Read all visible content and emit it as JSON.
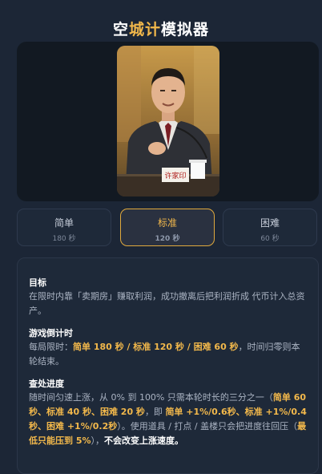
{
  "header": {
    "title_a": "空",
    "title_b": "城计",
    "title_c": "模拟器"
  },
  "photo": {
    "nameplate": "许家印"
  },
  "difficulty": [
    {
      "name": "简单",
      "time": "180 秒",
      "active": false
    },
    {
      "name": "标准",
      "time": "120 秒",
      "active": true
    },
    {
      "name": "困难",
      "time": "60 秒",
      "active": false
    }
  ],
  "rules": {
    "goal": {
      "title": "目标",
      "body": "在限时内靠「卖期房」赚取利润，成功撤离后把利润折成 代币计入总资产。"
    },
    "timer": {
      "title": "游戏倒计时",
      "body_a": "每局限时：",
      "body_b": "简单 180 秒 / 标准 120 秒 / 困难 60 秒",
      "body_c": "，时间归零则本轮结束。"
    },
    "progress": {
      "title": "查处进度",
      "p1": "随时间匀速上涨，从 0% 到 100% 只需本轮时长的三分之一（",
      "p2": "简单 60 秒、标准 40 秒、困难 20 秒",
      "p3": "，即 ",
      "p4": "简单 +1%/0.6秒、标准 +1%/0.4秒、困难 +1%/0.2秒",
      "p5": "）。使用道具 / 打点 / 盖楼只会把进度往回压（",
      "p6": "最低只能压到 5%",
      "p7": "），",
      "p8": "不会改变上涨速度。"
    }
  },
  "colors": {
    "accent": "#f2b84b",
    "background": "#1c2636",
    "panel": "#1e2939"
  }
}
